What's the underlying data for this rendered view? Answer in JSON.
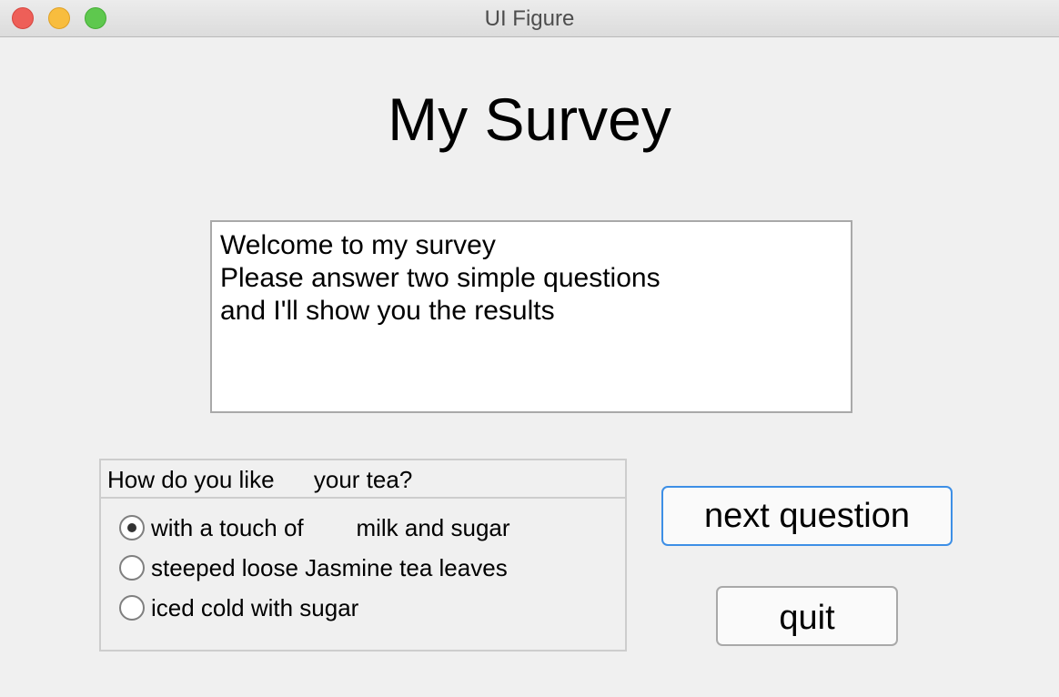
{
  "window": {
    "title": "UI Figure"
  },
  "heading": "My Survey",
  "intro": {
    "lines": [
      "Welcome to my survey",
      "Please answer two simple questions",
      "and I'll show you the results"
    ]
  },
  "question": {
    "title": "How do you like      your tea?",
    "options": [
      {
        "label": "with a touch of        milk and sugar",
        "selected": true
      },
      {
        "label": "steeped loose Jasmine tea leaves",
        "selected": false
      },
      {
        "label": "iced cold with sugar",
        "selected": false
      }
    ]
  },
  "buttons": {
    "next": "next question",
    "quit": "quit"
  },
  "colors": {
    "background": "#f0f0f0",
    "focus_border": "#3d8fe6",
    "close_light": "#ee5f58",
    "minimize_light": "#f8bd3e",
    "maximize_light": "#5ec84e"
  }
}
